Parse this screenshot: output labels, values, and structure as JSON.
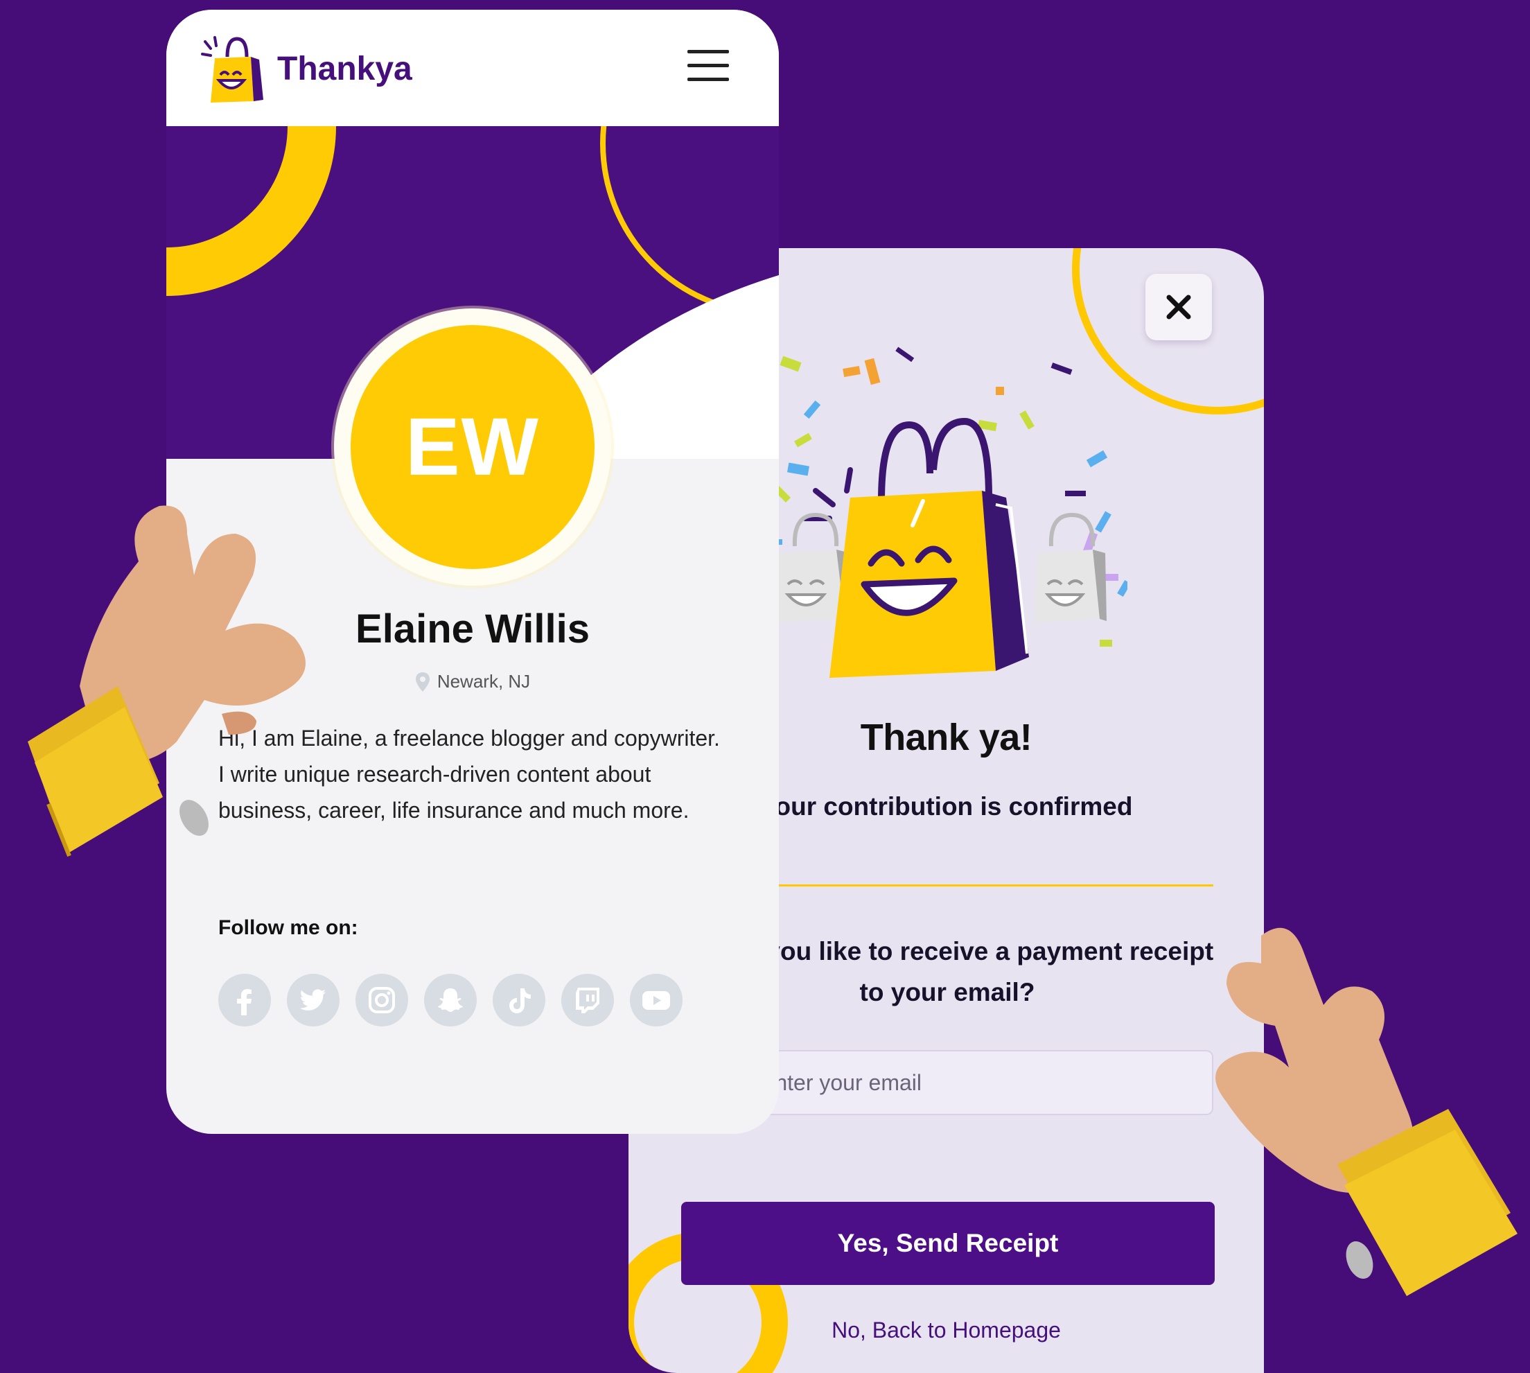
{
  "brand": {
    "name": "Thankya",
    "logo_icon": "smiling-shopping-bag"
  },
  "header": {
    "menu_icon": "hamburger-menu"
  },
  "profile": {
    "initials": "EW",
    "name": "Elaine Willis",
    "location": "Newark, NJ",
    "bio": "Hi, I am Elaine, a freelance blogger and copywriter. I write unique research-driven content about business, career, life insurance and much more.",
    "follow_label": "Follow me on:",
    "socials": [
      "facebook",
      "twitter",
      "instagram",
      "snapchat",
      "tiktok",
      "twitch",
      "youtube"
    ]
  },
  "modal": {
    "close_icon": "close-x",
    "illustration": "celebrating-shopping-bags-with-confetti",
    "title": "Thank ya!",
    "confirmation": "Your contribution is confirmed",
    "receipt_question": "Would you like to receive a payment receipt to your email?",
    "email_placeholder": "Enter your email",
    "send_button": "Yes, Send Receipt",
    "back_link": "No, Back to Homepage"
  },
  "colors": {
    "background": "#460d78",
    "brand_purple": "#4c0f87",
    "brand_yellow": "#ffcb05",
    "modal_bg": "#e8e3f0",
    "card_bg": "#f3f3f5",
    "social_icon_bg": "#d8dce3"
  }
}
